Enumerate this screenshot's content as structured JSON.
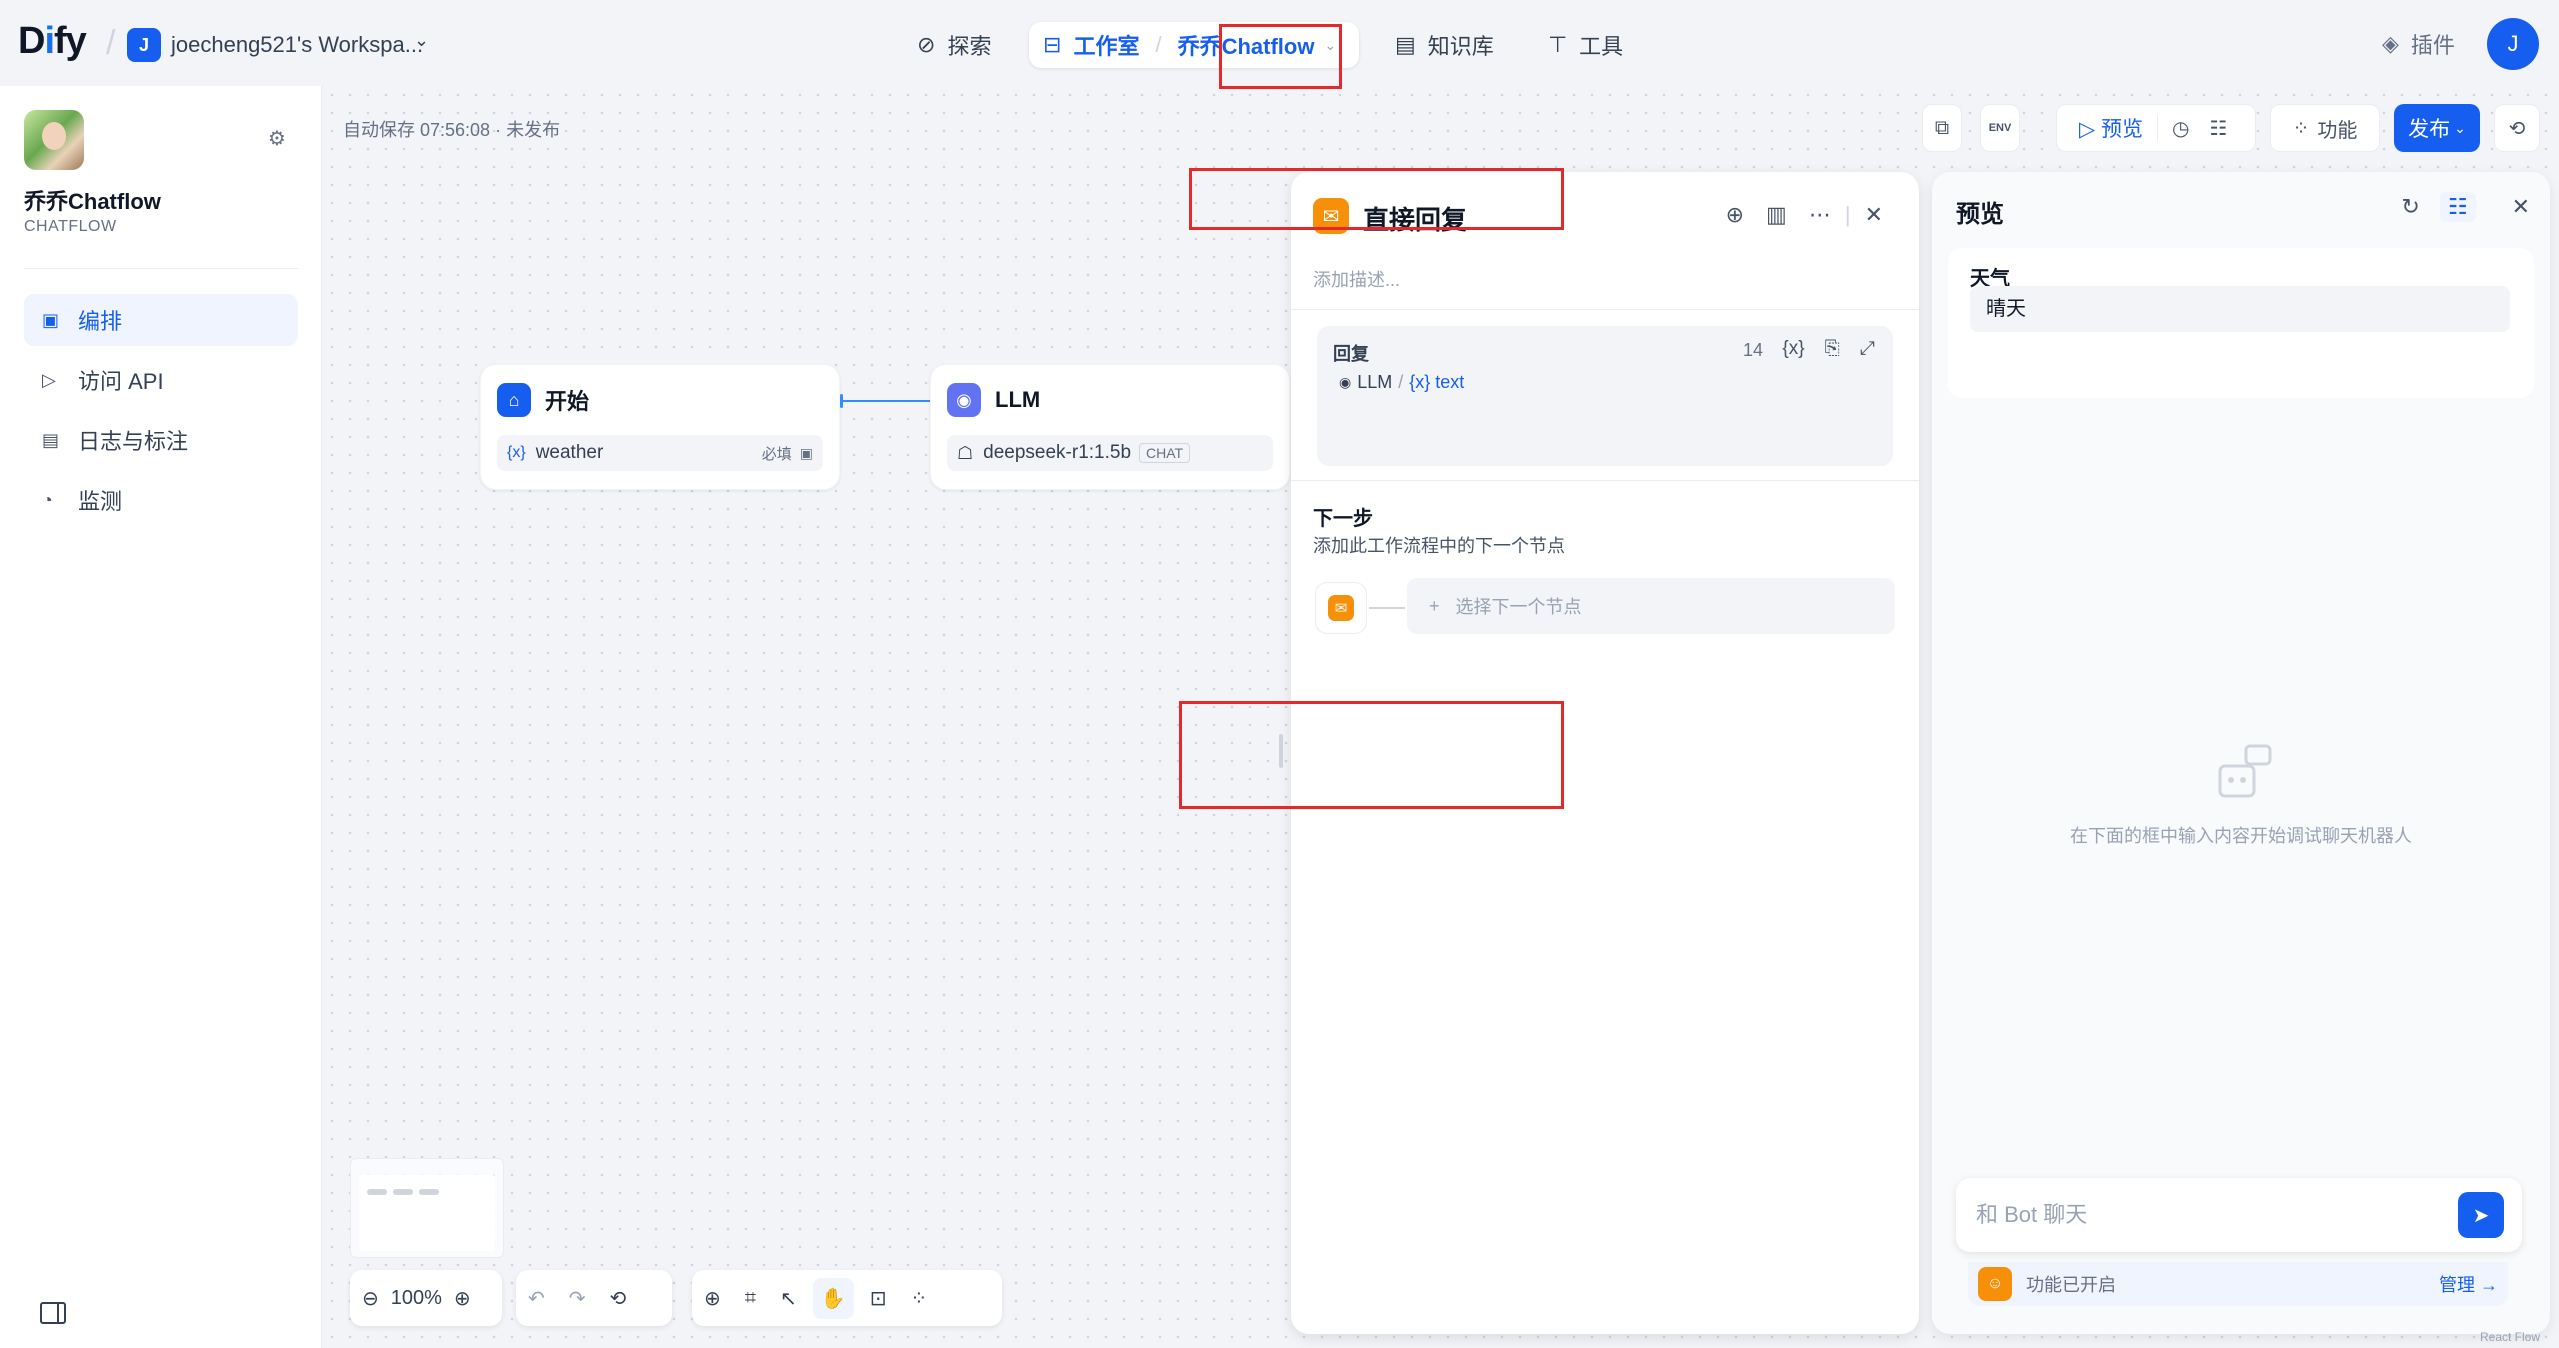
{
  "top": {
    "logo": "Dify",
    "workspace_initial": "J",
    "workspace_name": "joecheng521's Workspa...",
    "nav_explore": "探索",
    "nav_studio": "工作室",
    "nav_app": "乔乔Chatflow",
    "nav_knowledge": "知识库",
    "nav_tools": "工具",
    "plugins": "插件",
    "user_initial": "J"
  },
  "sidebar": {
    "app_name": "乔乔Chatflow",
    "app_type": "CHATFLOW",
    "items": [
      {
        "label": "编排",
        "icon": "layout-icon",
        "active": true
      },
      {
        "label": "访问 API",
        "icon": "terminal-icon",
        "active": false
      },
      {
        "label": "日志与标注",
        "icon": "log-icon",
        "active": false
      },
      {
        "label": "监测",
        "icon": "monitor-icon",
        "active": false
      }
    ]
  },
  "canvas": {
    "autosave": "自动保存 07:56:08 · 未发布",
    "toolbar": {
      "env": "ENV",
      "preview": "预览",
      "features": "功能",
      "publish": "发布"
    },
    "zoom": "100%"
  },
  "nodes": {
    "start": {
      "title": "开始",
      "var": "{x}",
      "var_name": "weather",
      "required": "必填"
    },
    "llm": {
      "title": "LLM",
      "model": "deepseek-r1:1.5b",
      "badge": "CHAT"
    }
  },
  "panel": {
    "title": "直接回复",
    "desc_placeholder": "添加描述...",
    "reply_label": "回复",
    "reply_count": "14",
    "reply_source": "LLM",
    "reply_var": "{x} text",
    "next_title": "下一步",
    "next_desc": "添加此工作流程中的下一个节点",
    "next_select": "选择下一个节点"
  },
  "preview": {
    "title": "预览",
    "field_label": "天气",
    "field_value": "晴天",
    "empty_text": "在下面的框中输入内容开始调试聊天机器人",
    "chat_placeholder": "和 Bot 聊天",
    "features_text": "功能已开启",
    "manage": "管理 →",
    "watermark": "React Flow"
  }
}
